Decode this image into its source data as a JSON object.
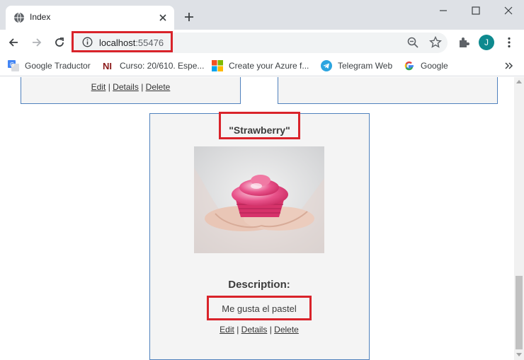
{
  "browser": {
    "tab_title": "Index",
    "url_host": "localhost",
    "url_port": ":55476",
    "avatar_letter": "J"
  },
  "bookmarks": [
    {
      "label": "Google Traductor",
      "icon": "google-translate-icon"
    },
    {
      "label": "Curso: 20/610. Espe...",
      "icon": "ni-icon"
    },
    {
      "label": "Create your Azure f...",
      "icon": "microsoft-icon"
    },
    {
      "label": "Telegram Web",
      "icon": "telegram-icon"
    },
    {
      "label": "Google",
      "icon": "google-icon"
    }
  ],
  "page": {
    "top_card_links": {
      "edit": "Edit",
      "details": "Details",
      "delete": "Delete",
      "sep": "|"
    },
    "product": {
      "title": "\"Strawberry\"",
      "description_label": "Description:",
      "description": "Me gusta el pastel",
      "links": {
        "edit": "Edit",
        "details": "Details",
        "delete": "Delete",
        "sep": "|"
      }
    }
  },
  "colors": {
    "highlight": "#d9232a",
    "card_border": "#4f81bd",
    "card_bg": "#f4f4f4"
  }
}
